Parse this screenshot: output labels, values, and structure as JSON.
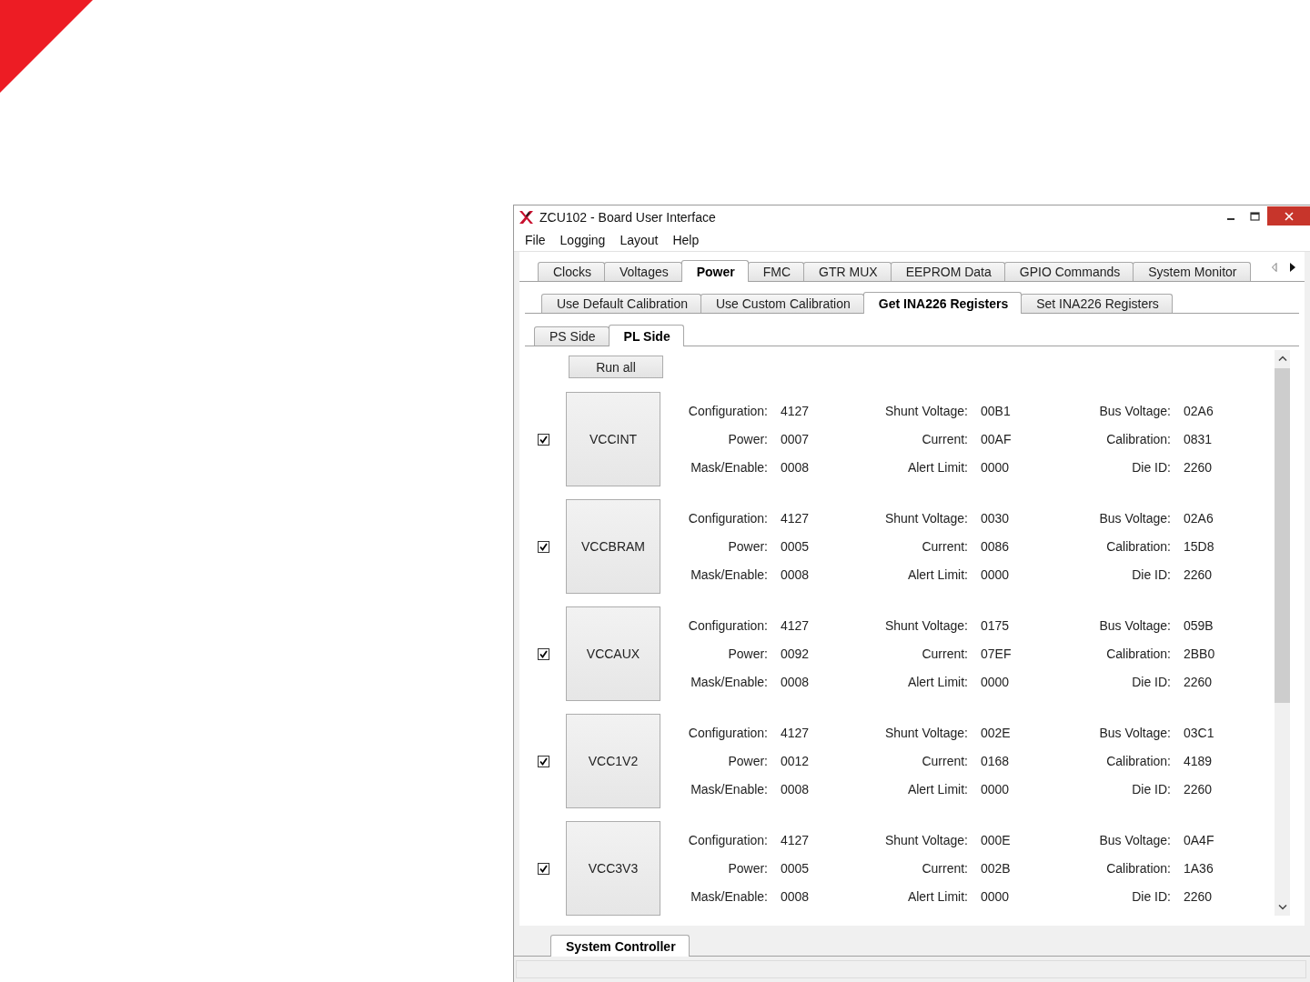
{
  "window": {
    "title": "ZCU102 - Board User Interface"
  },
  "menu": [
    "File",
    "Logging",
    "Layout",
    "Help"
  ],
  "main_tabs": [
    {
      "label": "Clocks",
      "selected": false
    },
    {
      "label": "Voltages",
      "selected": false
    },
    {
      "label": "Power",
      "selected": true
    },
    {
      "label": "FMC",
      "selected": false
    },
    {
      "label": "GTR MUX",
      "selected": false
    },
    {
      "label": "EEPROM Data",
      "selected": false
    },
    {
      "label": "GPIO Commands",
      "selected": false
    },
    {
      "label": "System Monitor",
      "selected": false
    }
  ],
  "power_tabs": [
    {
      "label": "Use Default Calibration",
      "selected": false
    },
    {
      "label": "Use Custom Calibration",
      "selected": false
    },
    {
      "label": "Get INA226 Registers",
      "selected": true
    },
    {
      "label": "Set INA226 Registers",
      "selected": false
    }
  ],
  "side_tabs": [
    {
      "label": "PS Side",
      "selected": false
    },
    {
      "label": "PL Side",
      "selected": true
    }
  ],
  "run_all": "Run all",
  "rails": [
    {
      "name": "VCCINT",
      "checked": true,
      "registers": [
        {
          "label": "Configuration:",
          "value": "4127"
        },
        {
          "label": "Shunt Voltage:",
          "value": "00B1"
        },
        {
          "label": "Bus Voltage:",
          "value": "02A6"
        },
        {
          "label": "Power:",
          "value": "0007"
        },
        {
          "label": "Current:",
          "value": "00AF"
        },
        {
          "label": "Calibration:",
          "value": "0831"
        },
        {
          "label": "Mask/Enable:",
          "value": "0008"
        },
        {
          "label": "Alert Limit:",
          "value": "0000"
        },
        {
          "label": "Die ID:",
          "value": "2260"
        }
      ]
    },
    {
      "name": "VCCBRAM",
      "checked": true,
      "registers": [
        {
          "label": "Configuration:",
          "value": "4127"
        },
        {
          "label": "Shunt Voltage:",
          "value": "0030"
        },
        {
          "label": "Bus Voltage:",
          "value": "02A6"
        },
        {
          "label": "Power:",
          "value": "0005"
        },
        {
          "label": "Current:",
          "value": "0086"
        },
        {
          "label": "Calibration:",
          "value": "15D8"
        },
        {
          "label": "Mask/Enable:",
          "value": "0008"
        },
        {
          "label": "Alert Limit:",
          "value": "0000"
        },
        {
          "label": "Die ID:",
          "value": "2260"
        }
      ]
    },
    {
      "name": "VCCAUX",
      "checked": true,
      "registers": [
        {
          "label": "Configuration:",
          "value": "4127"
        },
        {
          "label": "Shunt Voltage:",
          "value": "0175"
        },
        {
          "label": "Bus Voltage:",
          "value": "059B"
        },
        {
          "label": "Power:",
          "value": "0092"
        },
        {
          "label": "Current:",
          "value": "07EF"
        },
        {
          "label": "Calibration:",
          "value": "2BB0"
        },
        {
          "label": "Mask/Enable:",
          "value": "0008"
        },
        {
          "label": "Alert Limit:",
          "value": "0000"
        },
        {
          "label": "Die ID:",
          "value": "2260"
        }
      ]
    },
    {
      "name": "VCC1V2",
      "checked": true,
      "registers": [
        {
          "label": "Configuration:",
          "value": "4127"
        },
        {
          "label": "Shunt Voltage:",
          "value": "002E"
        },
        {
          "label": "Bus Voltage:",
          "value": "03C1"
        },
        {
          "label": "Power:",
          "value": "0012"
        },
        {
          "label": "Current:",
          "value": "0168"
        },
        {
          "label": "Calibration:",
          "value": "4189"
        },
        {
          "label": "Mask/Enable:",
          "value": "0008"
        },
        {
          "label": "Alert Limit:",
          "value": "0000"
        },
        {
          "label": "Die ID:",
          "value": "2260"
        }
      ]
    },
    {
      "name": "VCC3V3",
      "checked": true,
      "registers": [
        {
          "label": "Configuration:",
          "value": "4127"
        },
        {
          "label": "Shunt Voltage:",
          "value": "000E"
        },
        {
          "label": "Bus Voltage:",
          "value": "0A4F"
        },
        {
          "label": "Power:",
          "value": "0005"
        },
        {
          "label": "Current:",
          "value": "002B"
        },
        {
          "label": "Calibration:",
          "value": "1A36"
        },
        {
          "label": "Mask/Enable:",
          "value": "0008"
        },
        {
          "label": "Alert Limit:",
          "value": "0000"
        },
        {
          "label": "Die ID:",
          "value": "2260"
        }
      ]
    }
  ],
  "bottom_tabs": [
    {
      "label": "System Controller",
      "selected": true
    }
  ]
}
